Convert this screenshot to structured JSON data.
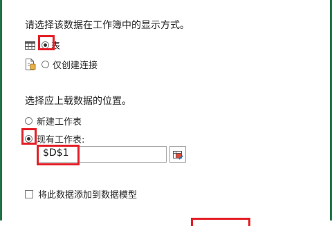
{
  "dialog": {
    "display_heading": "请选择该数据在工作簿中的显示方式。",
    "display_options": [
      {
        "label": "表",
        "selected": true,
        "icon": "table-icon"
      },
      {
        "label": "仅创建连接",
        "selected": false,
        "icon": "connection-only-icon"
      }
    ],
    "location_heading": "选择应上载数据的位置。",
    "location_options": [
      {
        "label": "新建工作表",
        "selected": false
      },
      {
        "label": "现有工作表:",
        "selected": true
      }
    ],
    "cell_reference": "$D$1",
    "add_to_model_label": "将此数据添加到数据模型",
    "add_to_model_checked": false
  },
  "colors": {
    "accent": "#217346",
    "highlight": "#e41e26"
  }
}
